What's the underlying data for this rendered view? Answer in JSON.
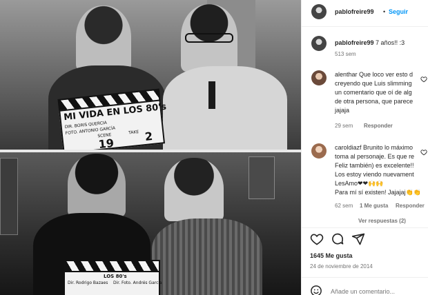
{
  "photo": {
    "top_clapboard": {
      "title": "MI VIDA EN LOS 80's",
      "line1": "DIR. BORIS QUERCIA",
      "line2": "FOTO. ANTONIO GARCÍA",
      "scene_label": "SCENE",
      "take_label": "TAKE",
      "scene": "19",
      "take": "2"
    },
    "bottom_clapboard": {
      "title": "LOS 80's",
      "line1": "Dir. Rodrigo Bazaes",
      "line2": "Dir. Foto. Andrés García"
    }
  },
  "header": {
    "username": "pablofreire99",
    "separator": "•",
    "follow_label": "Seguir"
  },
  "caption": {
    "username": "pablofreire99",
    "text": "7 años!! :3",
    "time": "513 sem"
  },
  "comments": [
    {
      "username": "alenthar",
      "lines": [
        "alenthar Que loco ver esto d",
        "creyendo que Luis slimming",
        "un comentario que oí de alg",
        "de otra persona, que parece",
        "jajaja"
      ],
      "time": "29 sem",
      "reply_label": "Responder"
    },
    {
      "username": "caroldiazf",
      "lines": [
        "caroldiazf Brunito lo máximo",
        "toma al personaje. Es que re",
        "Feliz también) es excelente!!",
        "Los estoy viendo nuevament",
        "LesAmo❤❤🙌🙌",
        "Para mí sí existen! Jajajaj👏👏"
      ],
      "time": "62 sem",
      "likes": "1 Me gusta",
      "reply_label": "Responder",
      "more_replies": "Ver respuestas (2)"
    }
  ],
  "actions": {
    "like_icon": "heart-icon",
    "comment_icon": "comment-icon",
    "share_icon": "share-icon"
  },
  "likes_text": "1645 Me gusta",
  "date_text": "24 de noviembre de 2014",
  "add_comment_placeholder": "Añade un comentario...",
  "colors": {
    "link": "#0095f6",
    "text": "#262626",
    "muted": "#737373",
    "heart_red": "#ed4956"
  }
}
